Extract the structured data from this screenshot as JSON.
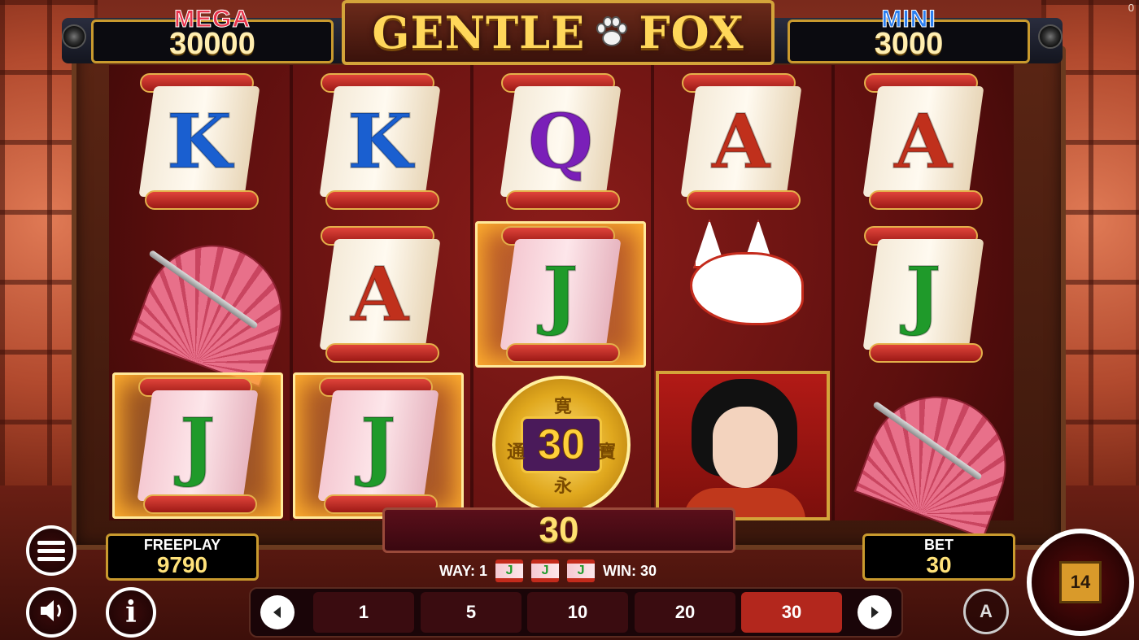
{
  "corner_label": "0",
  "jackpots": {
    "mega": {
      "title": "MEGA",
      "value": "30000"
    },
    "mini": {
      "title": "MINI",
      "value": "3000"
    }
  },
  "logo": {
    "word1": "GENTLE",
    "word2": "FOX",
    "icon": "paw-icon"
  },
  "reels": [
    {
      "col": 1,
      "symbols": [
        "K",
        "fan",
        "J"
      ],
      "colors": [
        "#1a5fd0",
        "",
        "#1f9a2a"
      ]
    },
    {
      "col": 2,
      "symbols": [
        "K",
        "A",
        "J"
      ],
      "colors": [
        "#1a5fd0",
        "#c0301c",
        "#1f9a2a"
      ]
    },
    {
      "col": 3,
      "symbols": [
        "Q",
        "J",
        "coin"
      ],
      "colors": [
        "#7a1fb8",
        "#1f9a2a",
        ""
      ]
    },
    {
      "col": 4,
      "symbols": [
        "A",
        "fox-mask",
        "geisha"
      ],
      "colors": [
        "#c0301c",
        "",
        ""
      ]
    },
    {
      "col": 5,
      "symbols": [
        "A",
        "J",
        "fan"
      ],
      "colors": [
        "#c0301c",
        "#1f9a2a",
        ""
      ]
    }
  ],
  "coin": {
    "value": "30",
    "glyphs": [
      "寛",
      "永",
      "通",
      "寶"
    ]
  },
  "win_bar": {
    "value": "30"
  },
  "way_line": {
    "way_label": "WAY: 1",
    "win_label": "WIN: 30",
    "symbol": "J"
  },
  "freeplay": {
    "label": "FREEPLAY",
    "value": "9790"
  },
  "bet": {
    "label": "BET",
    "value": "30"
  },
  "bet_options": [
    "1",
    "5",
    "10",
    "20",
    "30"
  ],
  "selected_bet": "30",
  "spin_cube_label": "14",
  "autoplay_label": "A",
  "info_label": "i"
}
